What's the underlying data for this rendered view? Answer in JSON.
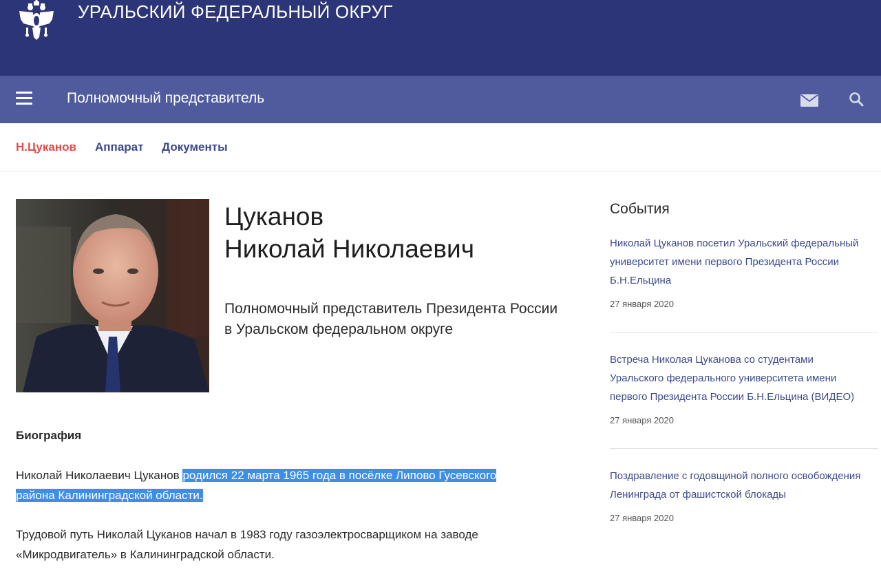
{
  "header": {
    "site_title": "УРАЛЬСКИЙ ФЕДЕРАЛЬНЫЙ ОКРУГ"
  },
  "navbar": {
    "title": "Полномочный представитель",
    "icons": [
      "menu-icon",
      "mail-icon",
      "search-icon"
    ]
  },
  "subnav": {
    "items": [
      {
        "label": "Н.Цуканов",
        "active": true
      },
      {
        "label": "Аппарат",
        "active": false
      },
      {
        "label": "Документы",
        "active": false
      }
    ]
  },
  "profile": {
    "surname": "Цуканов",
    "given_names": "Николай Николаевич",
    "position_line1": "Полномочный представитель Президента России",
    "position_line2": "в Уральском федеральном округе"
  },
  "biography": {
    "heading": "Биография",
    "p1_plain": "Николай Николаевич Цуканов ",
    "p1_highlight_1": "родился  22 марта 1965 года в посёлке Липово Гусевского",
    "p1_highlight_2": "района Калининградской области.",
    "p2_line1": "Трудовой путь Николай Цуканов начал в 1983 году газоэлектросварщиком на заводе",
    "p2_line2": "«Микродвигатель» в Калининградской области."
  },
  "events": {
    "heading": "События",
    "items": [
      {
        "lines": [
          "Николай Цуканов посетил Уральский федеральный",
          "университет имени первого Президента России",
          "Б.Н.Ельцина"
        ],
        "date": "27 января 2020"
      },
      {
        "lines": [
          "Встреча Николая Цуканова со студентами",
          "Уральского федерального университета имени",
          "первого Президента России Б.Н.Ельцина (ВИДЕО)"
        ],
        "date": "27 января 2020"
      },
      {
        "lines": [
          "Поздравление с годовщиной полного освобождения",
          "Ленинграда от фашистской блокады"
        ],
        "date": "27 января 2020"
      }
    ]
  },
  "colors": {
    "header_bg": "#2d3579",
    "navbar_bg": "#4f5b9d",
    "active_link": "#e24b4b",
    "link": "#3c4a8c",
    "selection": "#3e8ee8"
  }
}
